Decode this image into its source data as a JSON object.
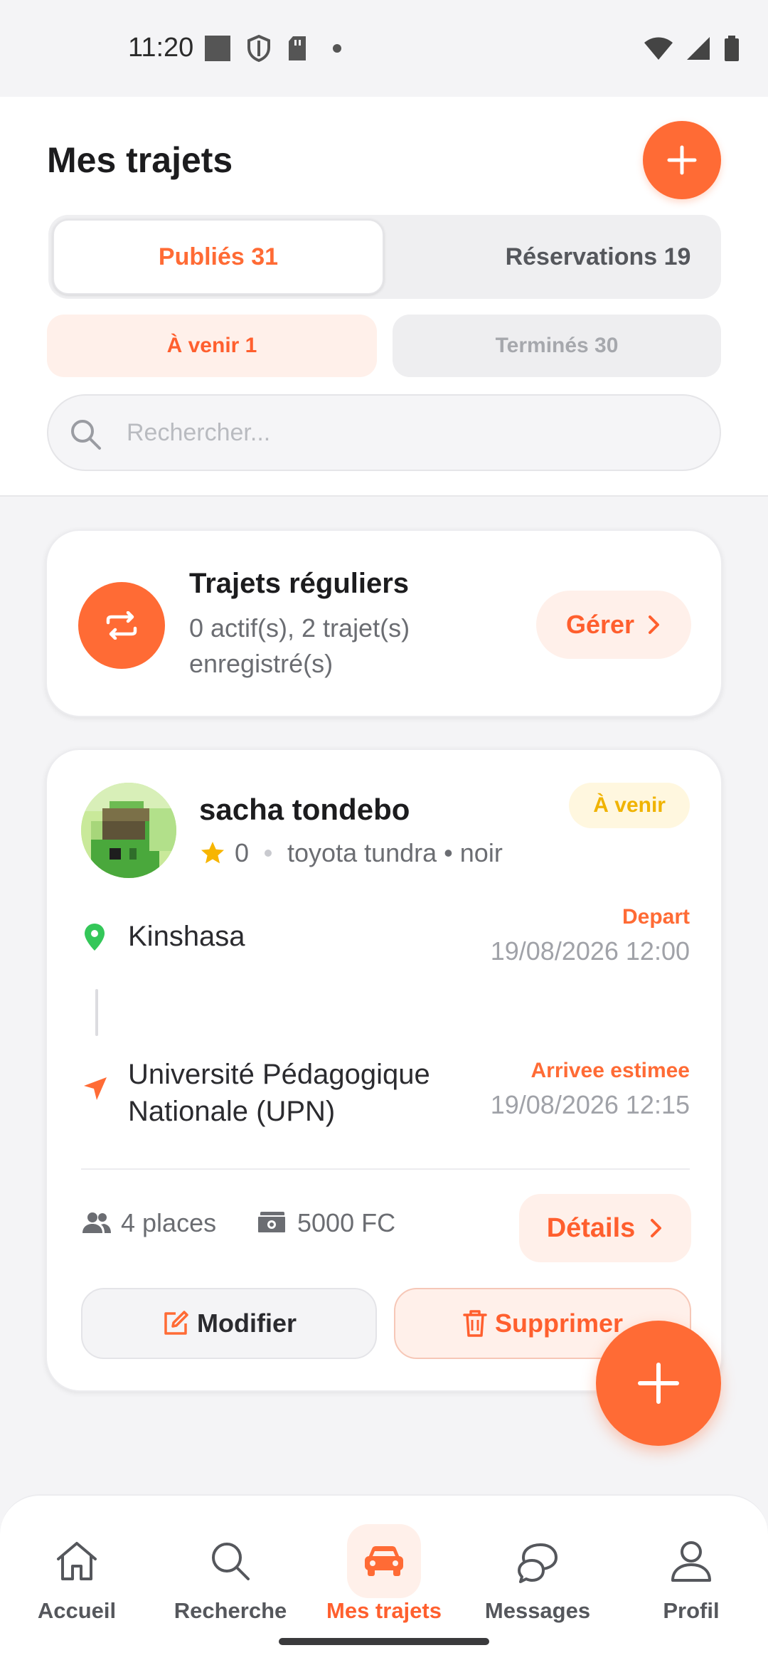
{
  "status_bar": {
    "time": "11:20",
    "left_icons": [
      "square-notification-icon",
      "shield-icon",
      "sd-card-icon",
      "dot-icon"
    ],
    "right_icons": [
      "wifi-icon",
      "signal-icon",
      "battery-icon"
    ]
  },
  "header": {
    "title": "Mes trajets",
    "add_icon": "plus-icon"
  },
  "main_tabs": [
    {
      "label": "Publiés 31",
      "active": true
    },
    {
      "label": "Réservations 19",
      "active": false
    }
  ],
  "sub_tabs": [
    {
      "label": "À venir 1",
      "active": true
    },
    {
      "label": "Terminés 30",
      "active": false
    }
  ],
  "search": {
    "placeholder": "Rechercher...",
    "value": ""
  },
  "regular_trips": {
    "title": "Trajets réguliers",
    "subtitle": "0 actif(s), 2 trajet(s) enregistré(s)",
    "manage_label": "Gérer",
    "icon": "repeat-arrows-icon"
  },
  "trip": {
    "driver_name": "sacha tondebo",
    "rating": "0",
    "vehicle": "toyota tundra • noir",
    "status": "À venir",
    "departure": {
      "label": "Depart",
      "place": "Kinshasa",
      "datetime": "19/08/2026 12:00"
    },
    "arrival": {
      "label": "Arrivee estimee",
      "place": "Université Pédagogique Nationale (UPN)",
      "datetime": "19/08/2026 12:15"
    },
    "seats": "4 places",
    "price": "5000 FC",
    "details_label": "Détails",
    "modify_label": "Modifier",
    "delete_label": "Supprimer"
  },
  "bottom_nav": [
    {
      "label": "Accueil",
      "icon": "home-icon",
      "active": false
    },
    {
      "label": "Recherche",
      "icon": "search-icon",
      "active": false
    },
    {
      "label": "Mes trajets",
      "icon": "car-icon",
      "active": true
    },
    {
      "label": "Messages",
      "icon": "chat-icon",
      "active": false
    },
    {
      "label": "Profil",
      "icon": "user-icon",
      "active": false
    }
  ],
  "colors": {
    "accent": "#ff6b35",
    "accent_light": "#fff0ea",
    "badge_yellow": "#f0b300",
    "location_green": "#34c759"
  }
}
